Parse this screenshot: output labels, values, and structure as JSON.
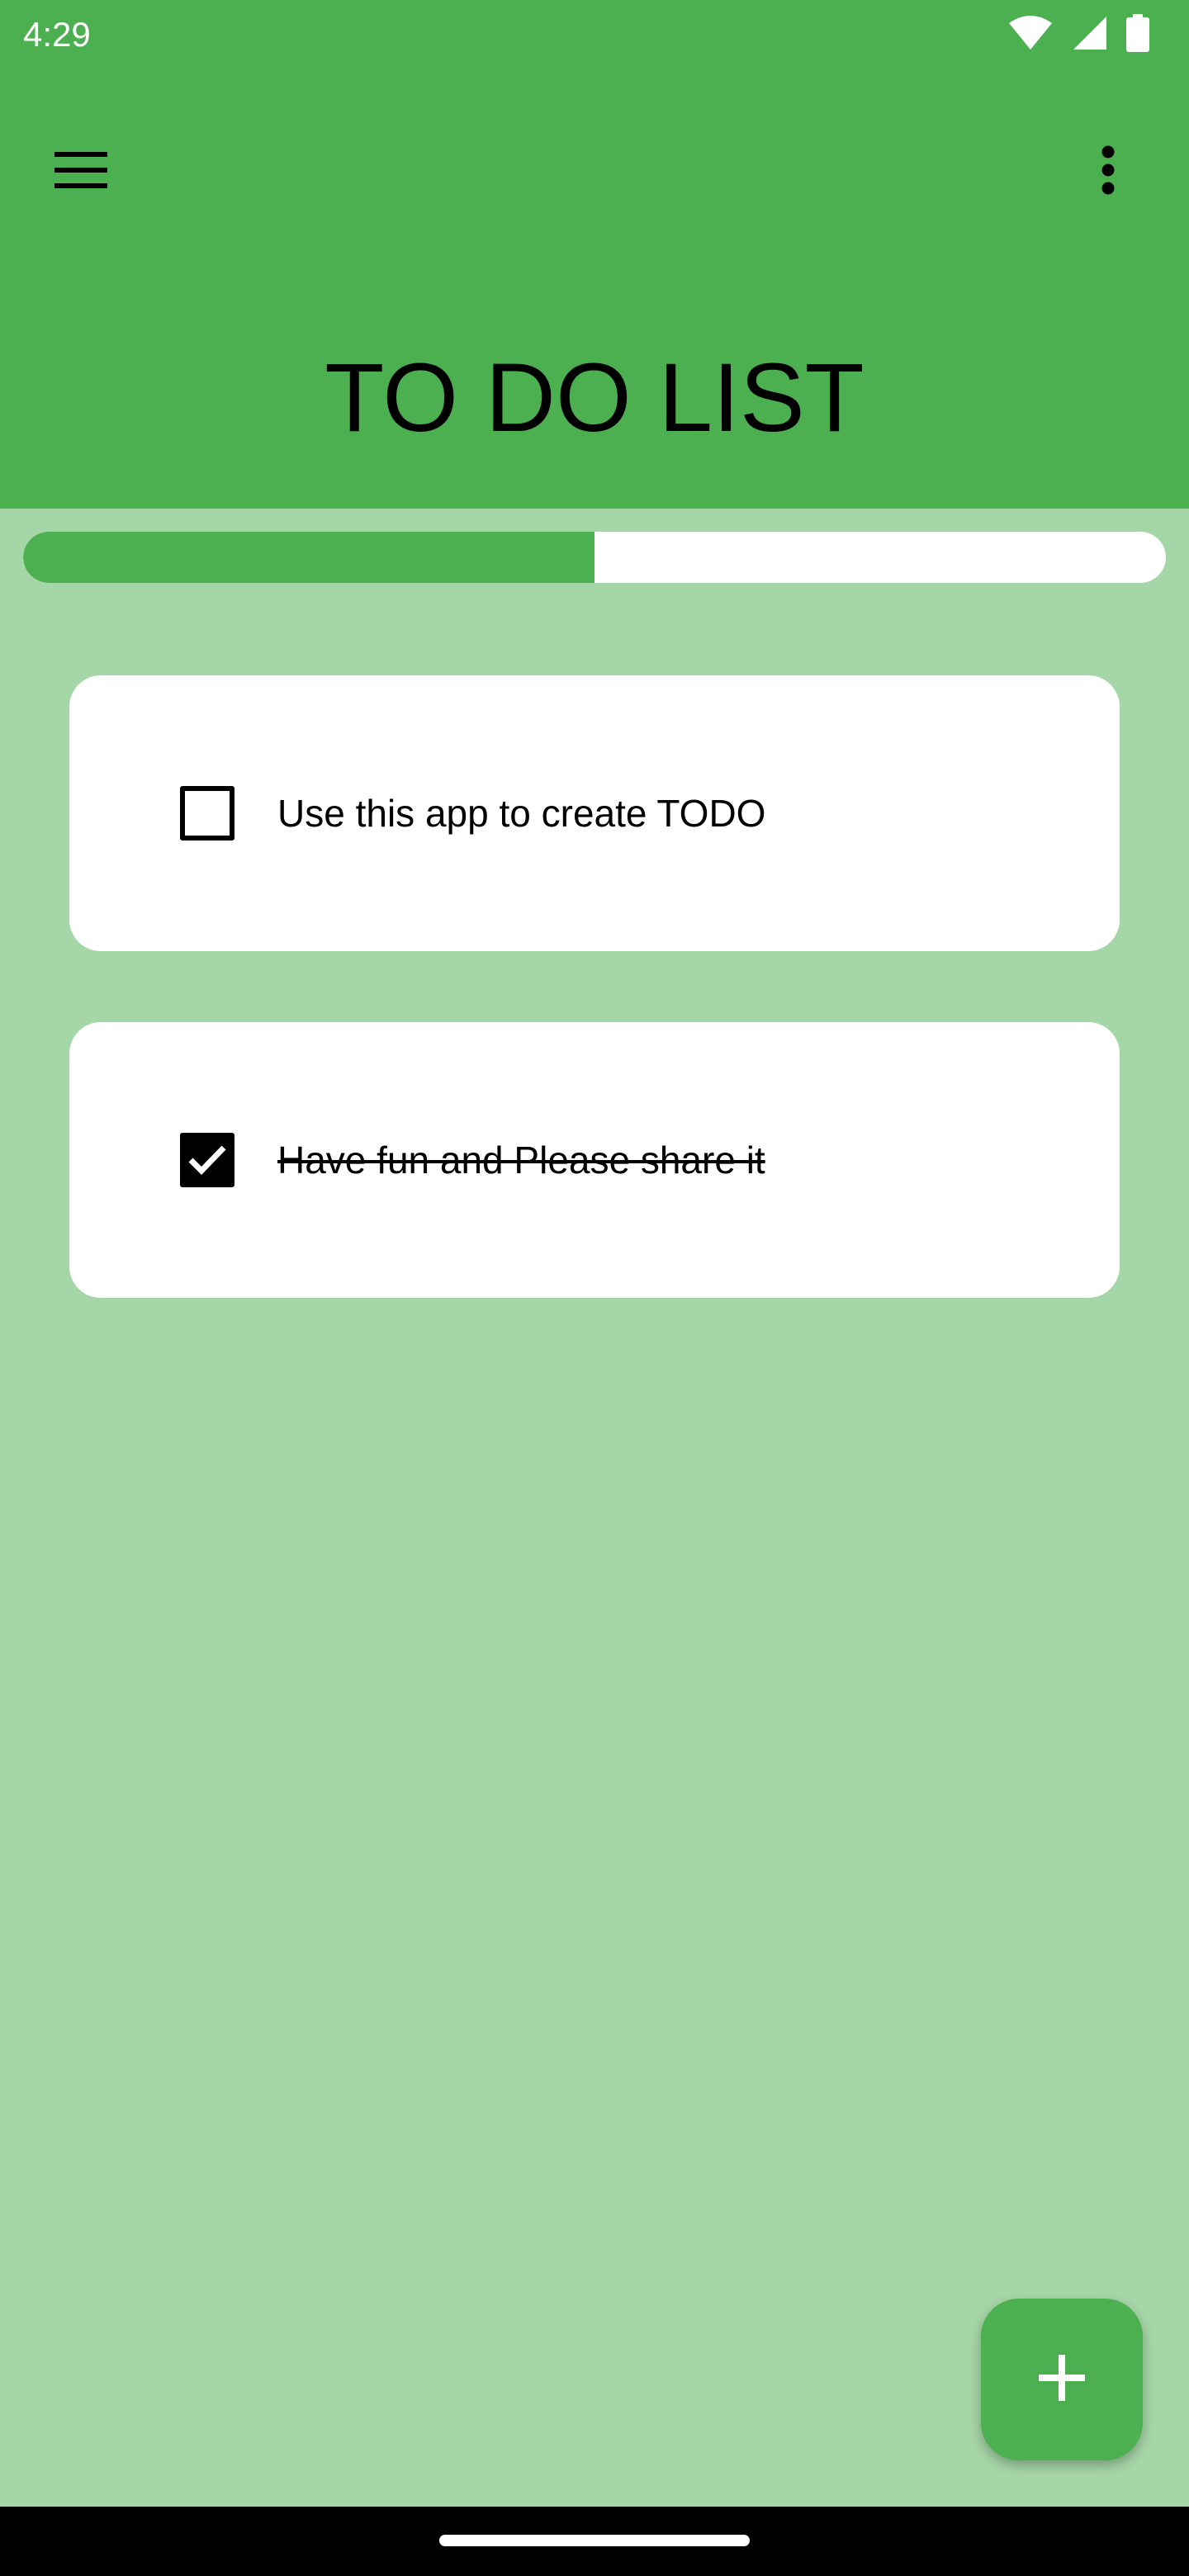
{
  "status_bar": {
    "time": "4:29",
    "icons": [
      "wifi-icon",
      "cellular-signal-icon",
      "battery-icon"
    ]
  },
  "app_bar": {
    "menu_icon": "hamburger-menu-icon",
    "overflow_icon": "more-vert-icon",
    "title": "TO DO LIST"
  },
  "progress": {
    "fraction_complete": 0.5
  },
  "todos": [
    {
      "text": "Use this app to create TODO",
      "checked": false
    },
    {
      "text": "Have fun and Please share it",
      "checked": true
    }
  ],
  "fab": {
    "icon": "plus-icon"
  },
  "colors": {
    "primary": "#4caf50",
    "background": "#a5d6a7",
    "card": "#ffffff",
    "text": "#000000"
  }
}
